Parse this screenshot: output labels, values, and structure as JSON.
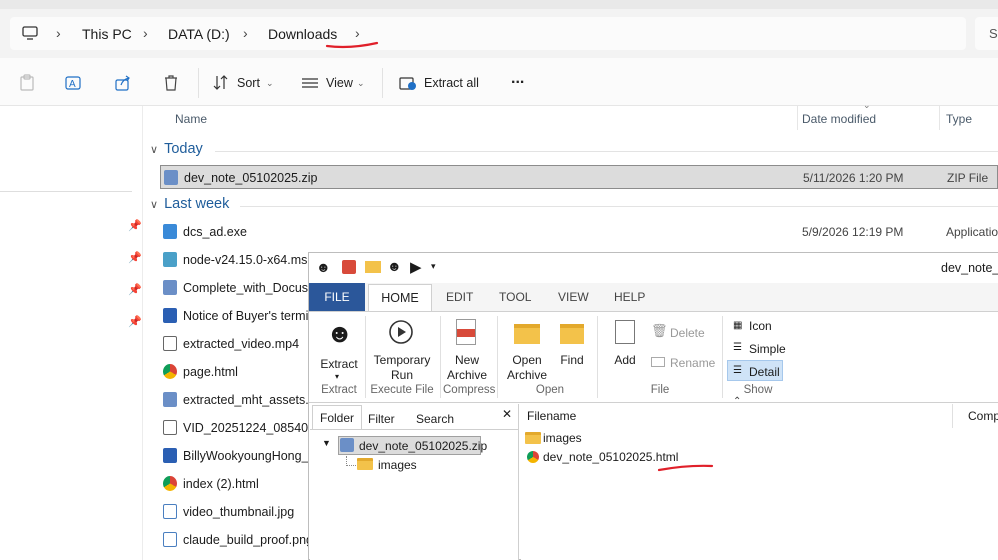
{
  "address_bar": {
    "crumbs": [
      "This PC",
      "DATA (D:)",
      "Downloads"
    ],
    "search_partial": "S"
  },
  "toolbar": {
    "sort_label": "Sort",
    "view_label": "View",
    "extract_all_label": "Extract all",
    "more_label": "..."
  },
  "file_list": {
    "columns": [
      "Name",
      "Date modified",
      "Type"
    ],
    "groups": [
      {
        "label": "Today",
        "items": [
          {
            "name": "dev_note_05102025.zip",
            "date": "5/11/2026 1:20 PM",
            "type": "ZIP File",
            "icon": "zip-icon"
          }
        ]
      },
      {
        "label": "Last week",
        "items": [
          {
            "name": "dcs_ad.exe",
            "date": "5/9/2026 12:19 PM",
            "type": "Applicatio",
            "icon": "exe-icon"
          },
          {
            "name": "node-v24.15.0-x64.msi",
            "icon": "msi-icon"
          },
          {
            "name": "Complete_with_Docusig",
            "icon": "zip-icon"
          },
          {
            "name": "Notice of Buyer's termir",
            "icon": "word-icon"
          },
          {
            "name": "extracted_video.mp4",
            "icon": "video-icon"
          },
          {
            "name": "page.html",
            "icon": "chrome-icon"
          },
          {
            "name": "extracted_mht_assets.zip",
            "icon": "zip-icon"
          },
          {
            "name": "VID_20251224_085407~3",
            "icon": "video-icon"
          },
          {
            "name": "BillyWookyoungHong_r",
            "icon": "word-icon"
          },
          {
            "name": "index (2).html",
            "icon": "chrome-icon"
          },
          {
            "name": "video_thumbnail.jpg",
            "icon": "image-icon"
          },
          {
            "name": "claude_build_proof.png",
            "icon": "image-icon"
          }
        ]
      }
    ]
  },
  "bandizip": {
    "title": "dev_note_0",
    "tabs": [
      "FILE",
      "HOME",
      "EDIT",
      "TOOL",
      "VIEW",
      "HELP"
    ],
    "ribbon": {
      "extract": "Extract",
      "temporary_run": "Temporary\nRun",
      "new_archive": "New\nArchive",
      "open_archive": "Open\nArchive",
      "find": "Find",
      "add": "Add",
      "delete": "Delete",
      "rename": "Rename",
      "view_icon": "Icon",
      "view_simple": "Simple",
      "view_detail": "Detail",
      "groups": [
        "Extract",
        "Execute File",
        "Compress",
        "Open",
        "File",
        "Show"
      ]
    },
    "tree_tabs": [
      "Folder",
      "Filter",
      "Search"
    ],
    "tree_close": "✕",
    "tree": {
      "root": "dev_note_05102025.zip",
      "child": "images"
    },
    "list_header": [
      "Filename",
      "Comp"
    ],
    "list_items": [
      {
        "name": "images",
        "icon": "folder-icon"
      },
      {
        "name": "dev_note_05102025.html",
        "icon": "chrome-icon"
      }
    ]
  },
  "colors": {
    "annotation_red": "#e0202a",
    "accent_blue": "#2b579a",
    "group_blue": "#1f5d9b"
  }
}
